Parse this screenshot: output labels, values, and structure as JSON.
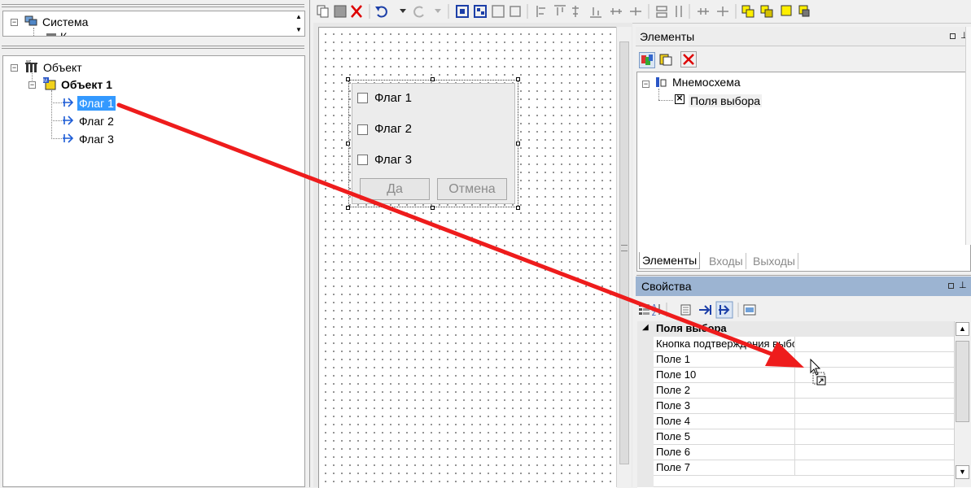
{
  "left_panel": {
    "system_tree": {
      "root_label": "Система",
      "child_label_partial": "К"
    },
    "object_tree": {
      "root_label": "Объект",
      "node_label": "Объект 1",
      "items": [
        "Флаг 1",
        "Флаг 2",
        "Флаг 3"
      ],
      "selected_index": 0
    }
  },
  "canvas": {
    "dialog": {
      "checkboxes": [
        "Флаг 1",
        "Флаг 2",
        "Флаг 3"
      ],
      "ok_label": "Да",
      "cancel_label": "Отмена"
    }
  },
  "elements_panel": {
    "title": "Элементы",
    "tree_root": "Мнемосхема",
    "tree_child": "Поля выбора",
    "tabs": [
      "Элементы",
      "Входы",
      "Выходы"
    ],
    "active_tab": 0
  },
  "properties_panel": {
    "title": "Свойства",
    "category": "Поля выбора",
    "rows": [
      {
        "name": "Кнопка подтверждения выбора",
        "value": ""
      },
      {
        "name": "Поле 1",
        "value": ""
      },
      {
        "name": "Поле 10",
        "value": ""
      },
      {
        "name": "Поле 2",
        "value": ""
      },
      {
        "name": "Поле 3",
        "value": ""
      },
      {
        "name": "Поле 4",
        "value": ""
      },
      {
        "name": "Поле 5",
        "value": ""
      },
      {
        "name": "Поле 6",
        "value": ""
      },
      {
        "name": "Поле 7",
        "value": ""
      }
    ]
  },
  "icons": {
    "toolbar": [
      "copy-icon",
      "paste-icon",
      "delete-icon",
      "undo-icon",
      "redo-icon",
      "group-icon",
      "ungroup-icon",
      "align-icon",
      "distribute-icon",
      "order-icon"
    ],
    "annotation_arrow_color": "#ee1c1c",
    "selection_color": "#3399ff"
  }
}
